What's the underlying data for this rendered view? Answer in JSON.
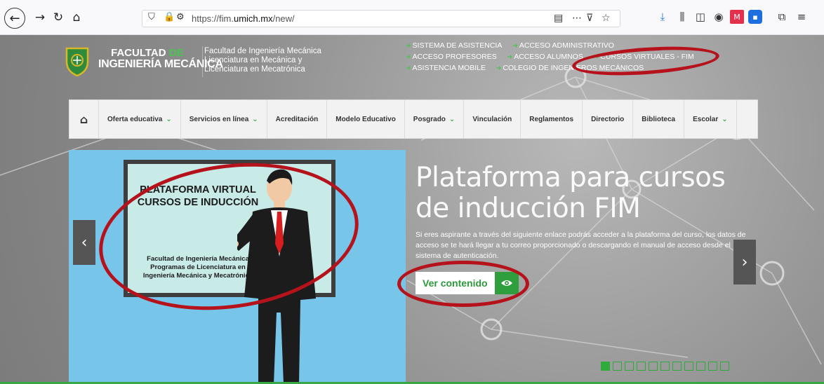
{
  "browser": {
    "url_prefix": "https://fim.",
    "url_domain": "umich.mx",
    "url_path": "/new/",
    "nav_icons": [
      "back-icon",
      "forward-icon",
      "reload-icon",
      "home-icon"
    ],
    "toolbar_icons": [
      "download-icon",
      "library-icon",
      "sidebar-icon",
      "account-icon",
      "extension-icon",
      "zoom-icon",
      "extensions-menu-icon"
    ]
  },
  "header": {
    "logo_line1_a": "FACULTAD",
    "logo_line1_b": "DE",
    "logo_line2": "INGENIERÍA MECÁNICA",
    "desc1": "Facultad de Ingeniería Mecánica",
    "desc2": "Licenciatura en Mecánica y",
    "desc3": "Licenciatura en Mecatrónica",
    "links": [
      "SISTEMA DE ASISTENCIA",
      "ACCESO ADMINISTRATIVO",
      "ACCESO PROFESORES",
      "ACCESO ALUMNOS",
      "CURSOS VIRTUALES - FIM",
      "ASISTENCIA MOBILE",
      "COLEGIO DE INGENIEROS MECÁNICOS"
    ]
  },
  "nav": {
    "items": [
      "Oferta educativa",
      "Servicios en línea",
      "Acreditación",
      "Modelo Educativo",
      "Posgrado",
      "Vinculación",
      "Reglamentos",
      "Directorio",
      "Biblioteca",
      "Escolar"
    ]
  },
  "slide": {
    "board_title1": "PLATAFORMA VIRTUAL",
    "board_title2": "CURSOS DE INDUCCIÓN",
    "board_foot1": "Facultad de Ingeniería Mecánica",
    "board_foot2": "Programas de Licenciatura  en",
    "board_foot3": "Ingeniería Mecánica y Mecatrónica",
    "title": "Plataforma para cursos de inducción FIM",
    "description": "Si eres aspirante a través del siguiente enlace podrás acceder a la plataforma del curso, los datos de acceso se te hará llegar a tu correo proporcionado o descargando el manual de acceso desde el sistema de autenticación.",
    "button": "Ver contenido",
    "prev": "‹",
    "next": "›",
    "dot_count": 11,
    "active_dot": 1
  },
  "colors": {
    "accent_green": "#2f9e3c",
    "annotation_red": "#b5121b"
  }
}
